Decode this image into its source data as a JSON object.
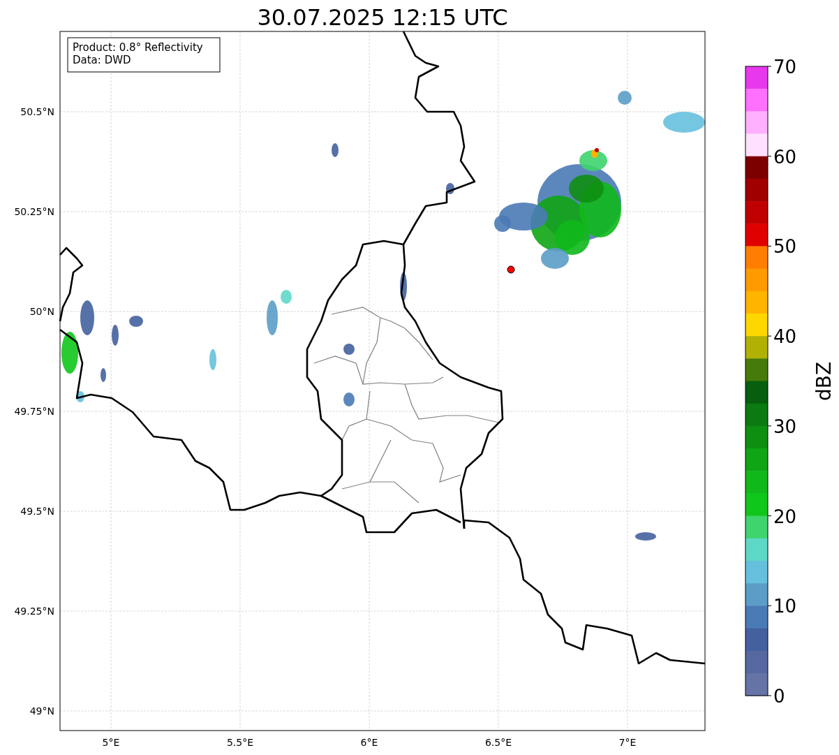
{
  "title": "30.07.2025 12:15 UTC",
  "info_box": {
    "lines": [
      "Product: 0.8° Reflectivity",
      "Data: DWD"
    ]
  },
  "map": {
    "x_ticks": [
      "5°E",
      "5.5°E",
      "6°E",
      "6.5°E",
      "7°E"
    ],
    "y_ticks": [
      "50.5°N",
      "50.25°N",
      "50°N",
      "49.75°N",
      "49.5°N",
      "49.25°N",
      "49°N"
    ]
  },
  "colorbar": {
    "label": "dBZ",
    "ticks": [
      "70",
      "60",
      "50",
      "40",
      "30",
      "20",
      "10",
      "0"
    ],
    "segments": [
      {
        "color": "#e838ee"
      },
      {
        "color": "#ff70ff"
      },
      {
        "color": "#ffb0ff"
      },
      {
        "color": "#ffe0ff"
      },
      {
        "color": "#7d0000"
      },
      {
        "color": "#a00000"
      },
      {
        "color": "#c00000"
      },
      {
        "color": "#e10000"
      },
      {
        "color": "#ff7e00"
      },
      {
        "color": "#ff9a00"
      },
      {
        "color": "#ffb400"
      },
      {
        "color": "#ffd700"
      },
      {
        "color": "#b1b105"
      },
      {
        "color": "#467a0a"
      },
      {
        "color": "#075e0e"
      },
      {
        "color": "#0b7a11"
      },
      {
        "color": "#0e8f11"
      },
      {
        "color": "#0fa514"
      },
      {
        "color": "#10b81a"
      },
      {
        "color": "#10c61a"
      },
      {
        "color": "#3fd46e"
      },
      {
        "color": "#5ed8c6"
      },
      {
        "color": "#66c0dd"
      },
      {
        "color": "#5b9dc6"
      },
      {
        "color": "#4a7ab5"
      },
      {
        "color": "#44609f"
      },
      {
        "color": "#5568a0"
      },
      {
        "color": "#6573a6"
      }
    ]
  }
}
